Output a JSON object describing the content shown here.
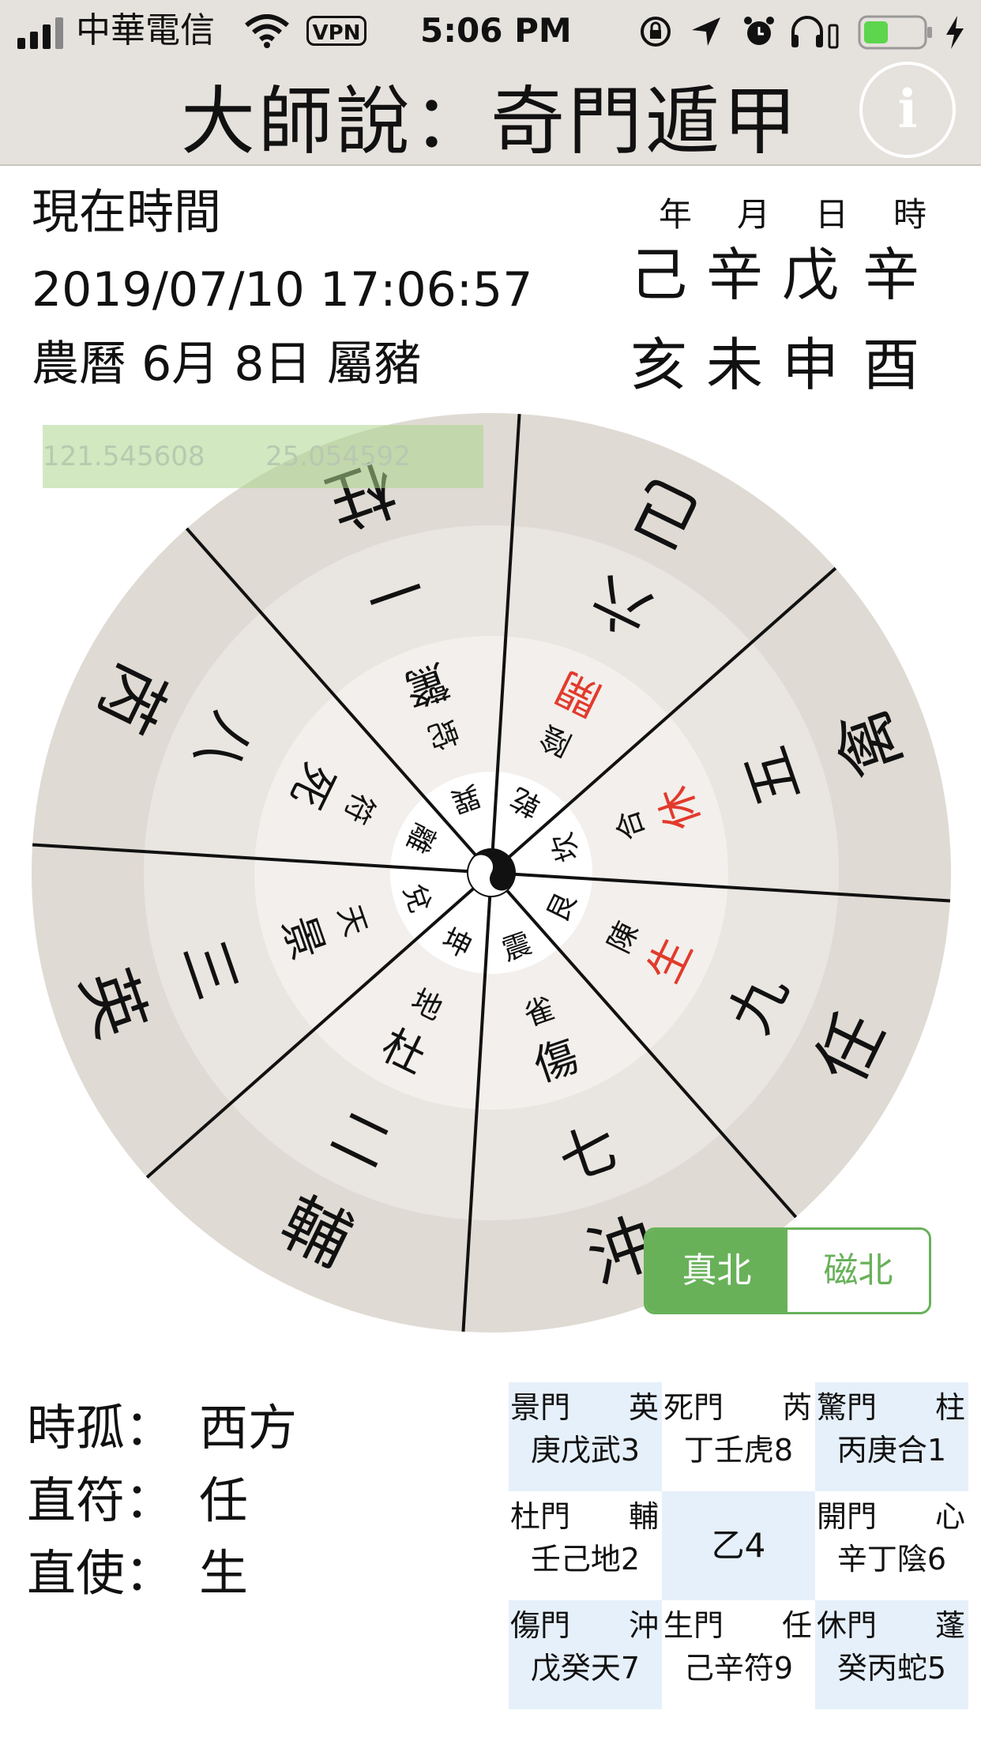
{
  "status_bar": {
    "carrier": "中華電信",
    "vpn": "VPN",
    "time": "5:06 PM",
    "icons": [
      "signal-icon",
      "wifi-icon",
      "orientation-lock-icon",
      "location-icon",
      "alarm-icon",
      "headphones-icon",
      "battery-icon",
      "charging-icon"
    ]
  },
  "header": {
    "title": "大師說：奇門遁甲",
    "info_label": "i"
  },
  "time_info": {
    "label": "現在時間",
    "datetime": "2019/07/10 17:06:57",
    "lunar": "農曆 6月 8日 屬豬"
  },
  "ganzhi": {
    "headers": [
      "年",
      "月",
      "日",
      "時"
    ],
    "stems": [
      "己",
      "辛",
      "戊",
      "辛"
    ],
    "branches": [
      "亥",
      "未",
      "申",
      "酉"
    ]
  },
  "location": {
    "lon": "121.545608",
    "lat": "25.054592"
  },
  "wheel": {
    "outer": [
      "己",
      "禽",
      "任",
      "沖",
      "輔",
      "英",
      "芮",
      "柱"
    ],
    "num": [
      "六",
      "五",
      "九",
      "七",
      "二",
      "三",
      "八",
      "一"
    ],
    "door": [
      "開",
      "休",
      "生",
      "傷",
      "杜",
      "景",
      "死",
      "驚"
    ],
    "door_red": [
      true,
      true,
      true,
      false,
      false,
      false,
      false,
      false
    ],
    "god": [
      "陰",
      "合",
      "陳",
      "雀",
      "地",
      "天",
      "符",
      "蛇"
    ],
    "trigram": [
      "乾",
      "坎",
      "艮",
      "震",
      "坤",
      "兌",
      "離",
      "巽"
    ],
    "colors": {
      "ring_outer": "#dfdad3",
      "ring_mid": "#e9e5e0",
      "ring_inner": "#f2efec",
      "ring_core": "#ffffff",
      "red": "#e23a2c"
    }
  },
  "north_toggle": {
    "true_north": "真北",
    "magnetic_north": "磁北",
    "selected": "true_north"
  },
  "summary": [
    {
      "label": "時孤：",
      "value": "西方"
    },
    {
      "label": "直符：",
      "value": "任"
    },
    {
      "label": "直使：",
      "value": "生"
    }
  ],
  "palace_grid": [
    {
      "door": "景門",
      "star": "英",
      "line2": "庚戊武3"
    },
    {
      "door": "死門",
      "star": "芮",
      "line2": "丁壬虎8"
    },
    {
      "door": "驚門",
      "star": "柱",
      "line2": "丙庚合1"
    },
    {
      "door": "杜門",
      "star": "輔",
      "line2": "壬己地2"
    },
    {
      "center": "乙4"
    },
    {
      "door": "開門",
      "star": "心",
      "line2": "辛丁陰6"
    },
    {
      "door": "傷門",
      "star": "沖",
      "line2": "戊癸天7"
    },
    {
      "door": "生門",
      "star": "任",
      "line2": "己辛符9"
    },
    {
      "door": "休門",
      "star": "蓬",
      "line2": "癸丙蛇5"
    }
  ]
}
